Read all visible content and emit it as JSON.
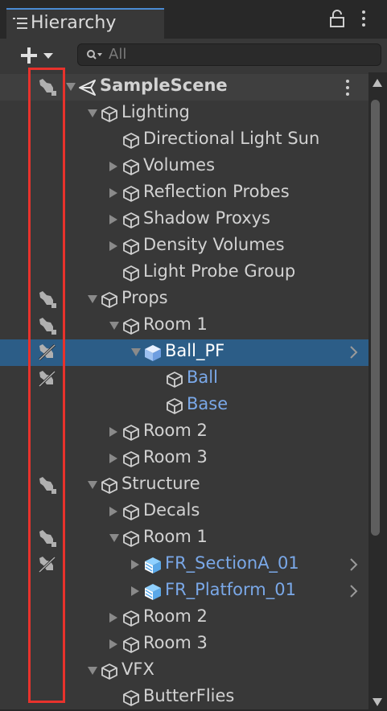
{
  "window": {
    "title": "Hierarchy",
    "icons": {
      "tab": "list-icon",
      "lock": "lock-icon",
      "menu": "kebab-icon"
    }
  },
  "toolbar": {
    "add_icon": "plus-dropdown-icon",
    "search_icon": "search-icon",
    "search_placeholder": "All"
  },
  "colors": {
    "accent": "#4a8bd4",
    "selected_row": "#2c5d87",
    "prefab_text": "#7aa8e8",
    "highlight_box": "#e8322c"
  },
  "rows": [
    {
      "label": "SampleScene",
      "kind": "scene",
      "arrow": "down",
      "vis": "pick"
    },
    {
      "label": "Lighting",
      "kind": "object",
      "arrow": "down"
    },
    {
      "label": "Directional Light Sun",
      "kind": "object"
    },
    {
      "label": "Volumes",
      "kind": "object",
      "arrow": "right"
    },
    {
      "label": "Reflection Probes",
      "kind": "object",
      "arrow": "right"
    },
    {
      "label": "Shadow Proxys",
      "kind": "object",
      "arrow": "right"
    },
    {
      "label": "Density Volumes",
      "kind": "object",
      "arrow": "right"
    },
    {
      "label": "Light Probe Group",
      "kind": "object"
    },
    {
      "label": "Props",
      "kind": "object",
      "arrow": "down",
      "vis": "pick"
    },
    {
      "label": "Room 1",
      "kind": "object",
      "arrow": "down",
      "vis": "pick"
    },
    {
      "label": "Ball_PF",
      "kind": "prefab",
      "arrow": "down",
      "vis": "nopick",
      "selected": true,
      "chevron": true
    },
    {
      "label": "Ball",
      "kind": "prefab-child",
      "vis": "nopick"
    },
    {
      "label": "Base",
      "kind": "prefab-child"
    },
    {
      "label": "Room 2",
      "kind": "object",
      "arrow": "right"
    },
    {
      "label": "Room 3",
      "kind": "object",
      "arrow": "right"
    },
    {
      "label": "Structure",
      "kind": "object",
      "arrow": "down",
      "vis": "pick"
    },
    {
      "label": "Decals",
      "kind": "object",
      "arrow": "right"
    },
    {
      "label": "Room 1",
      "kind": "object",
      "arrow": "down",
      "vis": "pick"
    },
    {
      "label": "FR_SectionA_01",
      "kind": "model-prefab",
      "arrow": "right",
      "vis": "nopick",
      "chevron": true
    },
    {
      "label": "FR_Platform_01",
      "kind": "model-prefab",
      "arrow": "right",
      "chevron": true
    },
    {
      "label": "Room 2",
      "kind": "object",
      "arrow": "right"
    },
    {
      "label": "Room 3",
      "kind": "object",
      "arrow": "right"
    },
    {
      "label": "VFX",
      "kind": "object",
      "arrow": "down"
    },
    {
      "label": "ButterFlies",
      "kind": "object"
    }
  ]
}
